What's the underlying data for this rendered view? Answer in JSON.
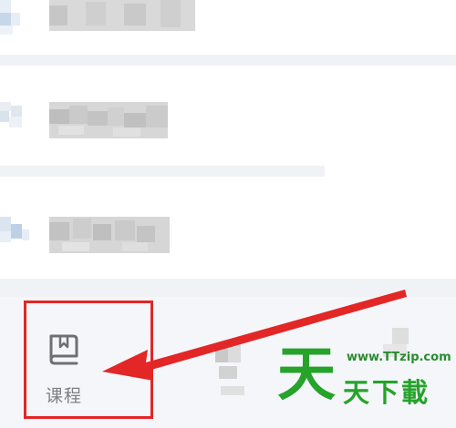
{
  "tabbar": {
    "courses_tab": {
      "label": "课程",
      "icon": "book-icon",
      "highlight_color": "#e32626"
    }
  },
  "watermark": {
    "logo_char": "天",
    "url": "www.TTzip.com",
    "name": "天下載",
    "color": "#25a32a"
  },
  "annotation": {
    "arrow_color": "#e32626"
  }
}
